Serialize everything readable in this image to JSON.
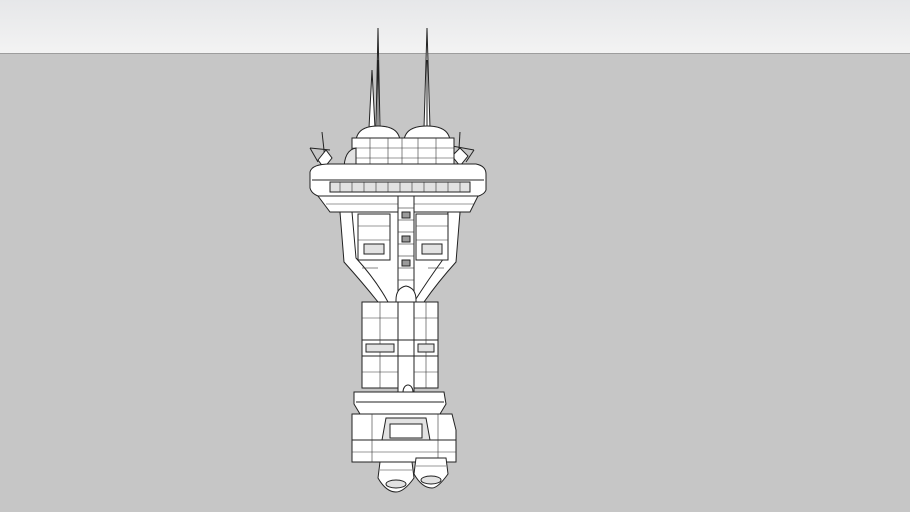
{
  "scene": {
    "model": "space-station-tower-wireframe",
    "render_style": "hidden-line",
    "colors": {
      "sky_top": "#e6e7e9",
      "sky_bottom": "#f3f3f3",
      "ground": "#c6c6c6",
      "edge": "#222222",
      "face": "#ffffff"
    }
  }
}
